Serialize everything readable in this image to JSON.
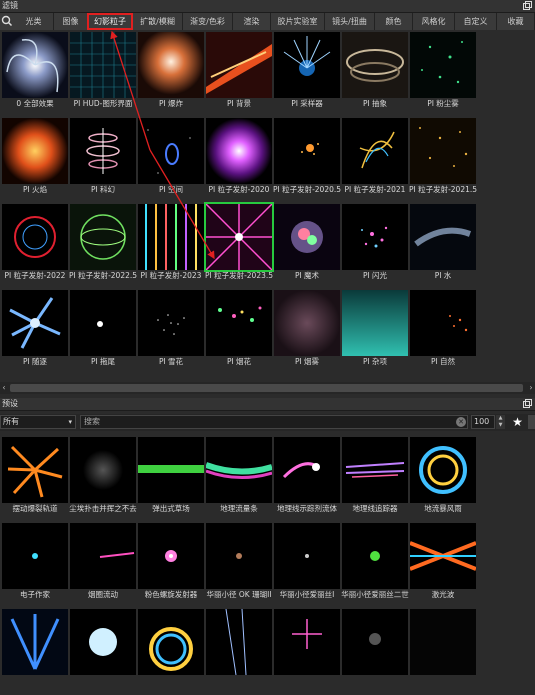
{
  "filters_panel": {
    "title": "滤镜",
    "tabs": [
      "光类",
      "图像",
      "幻影粒子",
      "扩散/模糊",
      "渐变/色彩",
      "渲染",
      "胶片实验室",
      "镜头/扭曲",
      "颜色",
      "风格化",
      "自定义",
      "收藏"
    ],
    "active_tab": "幻影粒子",
    "items": [
      {
        "label": "0 全部效果",
        "icon": "vortex-thumb"
      },
      {
        "label": "PI HUD-图形界面",
        "icon": "hud-grid-thumb"
      },
      {
        "label": "PI 爆炸",
        "icon": "explosion-thumb"
      },
      {
        "label": "PI 背景",
        "icon": "streak-background-thumb"
      },
      {
        "label": "PI 采样器",
        "icon": "sampler-burst-thumb"
      },
      {
        "label": "PI 抽象",
        "icon": "abstract-swirl-thumb"
      },
      {
        "label": "PI 粉尘雾",
        "icon": "dust-fog-thumb"
      },
      {
        "label": "PI 火焰",
        "icon": "fire-thumb"
      },
      {
        "label": "PI 科幻",
        "icon": "scifi-ring-thumb"
      },
      {
        "label": "PI 空间",
        "icon": "space-portal-thumb"
      },
      {
        "label": "PI 粒子发射-2020",
        "icon": "purple-burst-thumb"
      },
      {
        "label": "PI 粒子发射-2020.5",
        "icon": "orange-spark-thumb"
      },
      {
        "label": "PI 粒子发射-2021",
        "icon": "particle-tendril-thumb"
      },
      {
        "label": "PI 粒子发射-2021.5",
        "icon": "golden-rain-thumb"
      },
      {
        "label": "PI 粒子发射-2022",
        "icon": "red-circle-thumb"
      },
      {
        "label": "PI 粒子发射-2022.5",
        "icon": "green-orb-thumb"
      },
      {
        "label": "PI 粒子发射-2023",
        "icon": "color-lines-thumb"
      },
      {
        "label": "PI 粒子发射-2023.5",
        "icon": "magenta-tunnel-thumb"
      },
      {
        "label": "PI 魔术",
        "icon": "magic-orb-thumb"
      },
      {
        "label": "PI 闪光",
        "icon": "flash-thumb"
      },
      {
        "label": "PI 水",
        "icon": "water-thumb"
      },
      {
        "label": "PI 随逐",
        "icon": "blue-spiral-thumb"
      },
      {
        "label": "PI 拖尾",
        "icon": "comet-tail-thumb"
      },
      {
        "label": "PI 雪花",
        "icon": "snow-thumb"
      },
      {
        "label": "PI 烟花",
        "icon": "fireworks-thumb"
      },
      {
        "label": "PI 烟雾",
        "icon": "smoke-thumb"
      },
      {
        "label": "PI 杂项",
        "icon": "teal-glow-thumb"
      },
      {
        "label": "PI 自然",
        "icon": "nature-particles-thumb"
      }
    ]
  },
  "presets_panel": {
    "title": "预设",
    "dropdown_value": "所有",
    "search_placeholder": "搜索",
    "size_value": "100",
    "items": [
      {
        "label": "摆动爆裂轨道",
        "icon": "orange-burst-thumb"
      },
      {
        "label": "尘埃扑击并挥之不去",
        "icon": "dust-cloud-thumb"
      },
      {
        "label": "弹出式草场",
        "icon": "grass-line-thumb"
      },
      {
        "label": "地理流量条",
        "icon": "rainbow-wave-thumb"
      },
      {
        "label": "地理线示踪剂流体",
        "icon": "tracer-fluid-thumb"
      },
      {
        "label": "地理线追踪器",
        "icon": "line-tracker-thumb"
      },
      {
        "label": "地流暴风雨",
        "icon": "storm-swirl-thumb"
      },
      {
        "label": "电子作家",
        "icon": "cyan-dot-thumb"
      },
      {
        "label": "烟圈流动",
        "icon": "pink-line-thumb"
      },
      {
        "label": "粉色螺旋发射器",
        "icon": "pink-spiral-thumb"
      },
      {
        "label": "华丽小径 OK 珊瑚II",
        "icon": "faint-coral-thumb"
      },
      {
        "label": "华丽小径爱丽丝I",
        "icon": "alice-glow-thumb"
      },
      {
        "label": "华丽小径爱丽丝二世",
        "icon": "green-spark-thumb"
      },
      {
        "label": "激光波",
        "icon": "laser-wave-thumb"
      },
      {
        "label": "",
        "icon": "blue-fan-thumb"
      },
      {
        "label": "",
        "icon": "white-starburst-thumb"
      },
      {
        "label": "",
        "icon": "rainbow-ring-thumb"
      },
      {
        "label": "",
        "icon": "light-rays-thumb"
      },
      {
        "label": "",
        "icon": "pink-star-thumb"
      },
      {
        "label": "",
        "icon": "dim-glow-thumb"
      },
      {
        "label": "",
        "icon": "dark-thumb"
      }
    ]
  },
  "colors": {
    "panel_bg": "#2b2b2b",
    "highlight_red": "#e12020",
    "selection_green": "#27c93f"
  }
}
